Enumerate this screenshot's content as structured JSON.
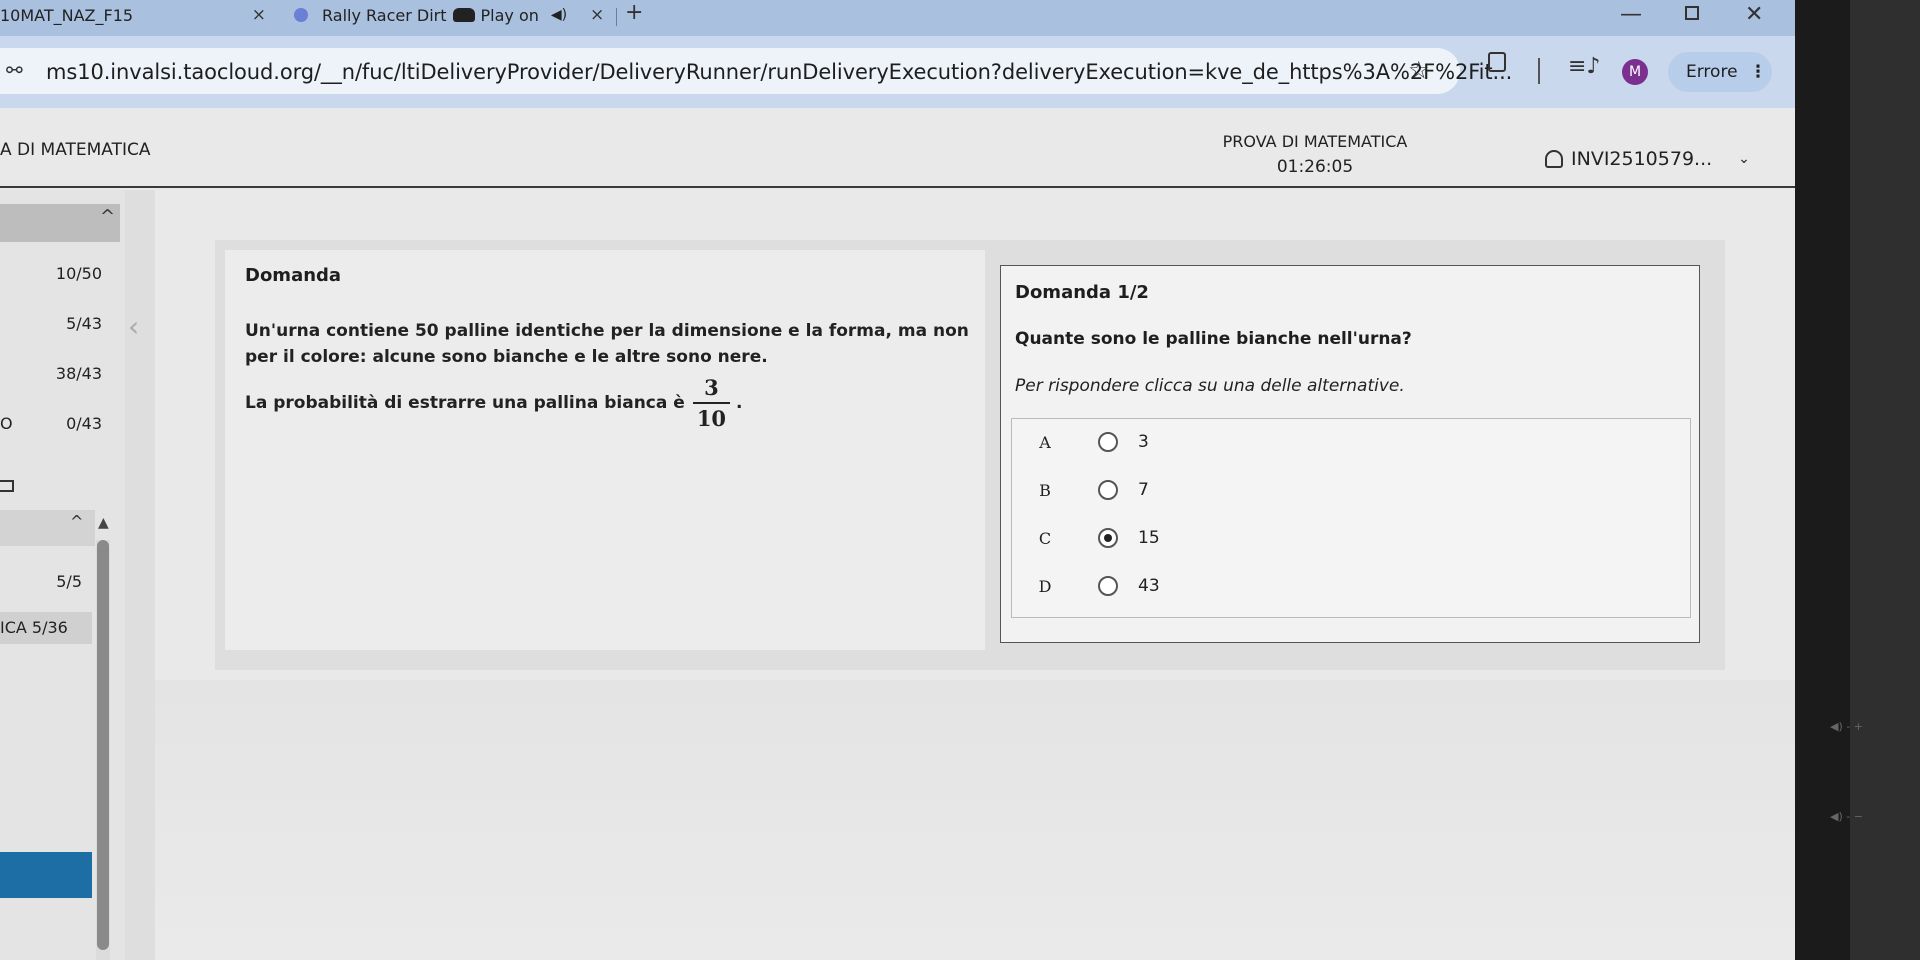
{
  "browser": {
    "tabs": [
      {
        "label": "10MAT_NAZ_F15",
        "close": "×"
      },
      {
        "label": "Rally Racer Dirt",
        "label2": "Play on",
        "audio": "◀)",
        "close": "×"
      }
    ],
    "new_tab": "+",
    "window": {
      "minimize": "—",
      "close": "✕"
    },
    "address": {
      "url": "ms10.invalsi.taocloud.org/__n/fuc/ltiDeliveryProvider/DeliveryRunner/runDeliveryExecution?deliveryExecution=kve_de_https%3A%2F%2Fit...",
      "site_icon": "⚯",
      "star": "☆"
    },
    "profile_initial": "M",
    "error_button": {
      "label": "Errore",
      "menu": "⋮"
    },
    "media_icon": "≡♪"
  },
  "test": {
    "title_left": "A DI MATEMATICA",
    "center_title": "PROVA DI MATEMATICA",
    "timer": "01:26:05",
    "user": "INVI2510579...",
    "user_chevron": "⌄"
  },
  "sidebar": {
    "collapse_icon": "^",
    "rows": [
      {
        "prefix": "",
        "value": "10/50"
      },
      {
        "prefix": "",
        "value": "5/43"
      },
      {
        "prefix": "",
        "value": "38/43"
      },
      {
        "prefix": "O",
        "value": "0/43"
      }
    ],
    "collapse2_icon": "^",
    "section2_value": "5/5",
    "active_label": "ICA  5/36",
    "prev_arrow": "‹",
    "scroll_up": "▲"
  },
  "question_panel": {
    "heading": "Domanda",
    "stem": "Un'urna contiene 50 palline identiche per la dimensione e la forma, ma non per il colore: alcune sono bianche e le altre sono nere.",
    "prob_text": "La probabilità di estrarre una pallina bianca è",
    "fraction": {
      "numerator": "3",
      "denominator": "10"
    },
    "prob_end": "."
  },
  "answer_panel": {
    "counter": "Domanda 1/2",
    "question": "Quante sono le palline bianche nell'urna?",
    "instruction": "Per rispondere clicca su una delle alternative.",
    "choices": [
      {
        "letter": "A",
        "value": "3",
        "selected": false
      },
      {
        "letter": "B",
        "value": "7",
        "selected": false
      },
      {
        "letter": "C",
        "value": "15",
        "selected": true
      },
      {
        "letter": "D",
        "value": "43",
        "selected": false
      }
    ]
  },
  "bezel": {
    "glyph1": "◀) ‑ +",
    "glyph2": "◀) ‑ −"
  }
}
